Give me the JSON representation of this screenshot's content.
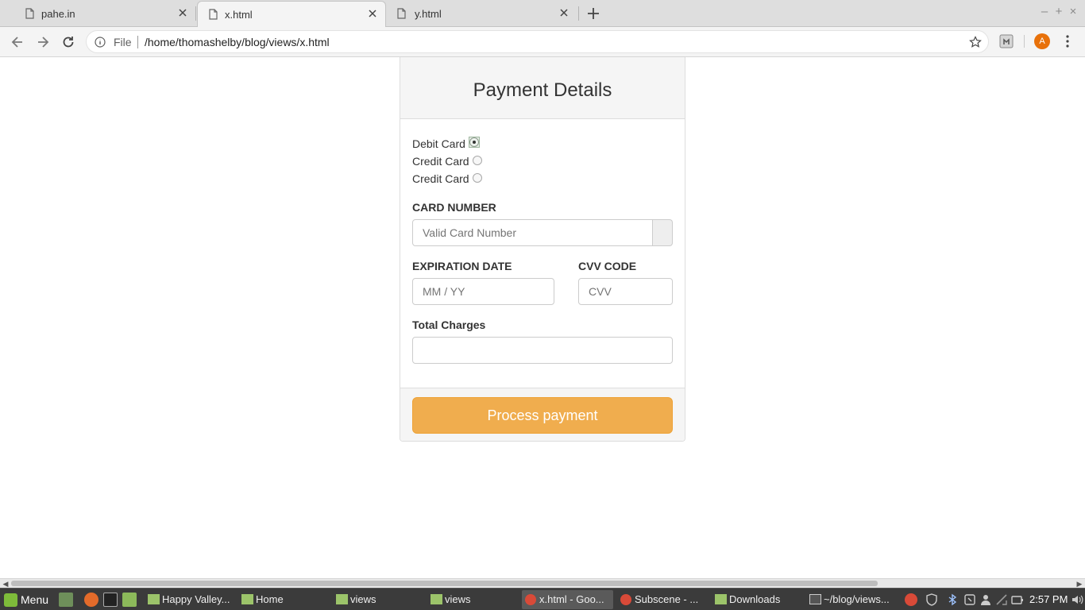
{
  "browser": {
    "tabs": [
      {
        "title": "pahe.in",
        "active": false
      },
      {
        "title": "x.html",
        "active": true
      },
      {
        "title": "y.html",
        "active": false
      }
    ],
    "omnibox": {
      "scheme": "File",
      "url": "/home/thomashelby/blog/views/x.html"
    },
    "avatar_letter": "A",
    "window_controls": {
      "minimize": "–",
      "maximize": "+",
      "close": "×"
    }
  },
  "page": {
    "title": "Payment Details",
    "card_options": [
      {
        "label": "Debit Card",
        "checked": true
      },
      {
        "label": "Credit Card",
        "checked": false
      },
      {
        "label": "Credit Card",
        "checked": false
      }
    ],
    "card_number": {
      "label": "CARD NUMBER",
      "placeholder": "Valid Card Number",
      "value": ""
    },
    "expiration": {
      "label": "EXPIRATION DATE",
      "placeholder": "MM / YY",
      "value": ""
    },
    "cvv": {
      "label": "CVV CODE",
      "placeholder": "CVV",
      "value": ""
    },
    "total": {
      "label": "Total Charges",
      "value": ""
    },
    "submit_label": "Process payment",
    "accent_color": "#f0ad4e"
  },
  "taskbar": {
    "menu_label": "Menu",
    "tasks": [
      {
        "label": "Happy Valley...",
        "icon": "folder-icon",
        "active": false
      },
      {
        "label": "Home",
        "icon": "folder-icon",
        "active": false
      },
      {
        "label": "views",
        "icon": "folder-icon",
        "active": false
      },
      {
        "label": "views",
        "icon": "folder-icon",
        "active": false
      },
      {
        "label": "x.html - Goo...",
        "icon": "chrome-icon",
        "active": true
      },
      {
        "label": "Subscene - ...",
        "icon": "chrome-icon",
        "active": false
      },
      {
        "label": "Downloads",
        "icon": "folder-icon",
        "active": false
      },
      {
        "label": "~/blog/views...",
        "icon": "sublime-icon",
        "active": false
      }
    ],
    "clock": "2:57 PM"
  }
}
